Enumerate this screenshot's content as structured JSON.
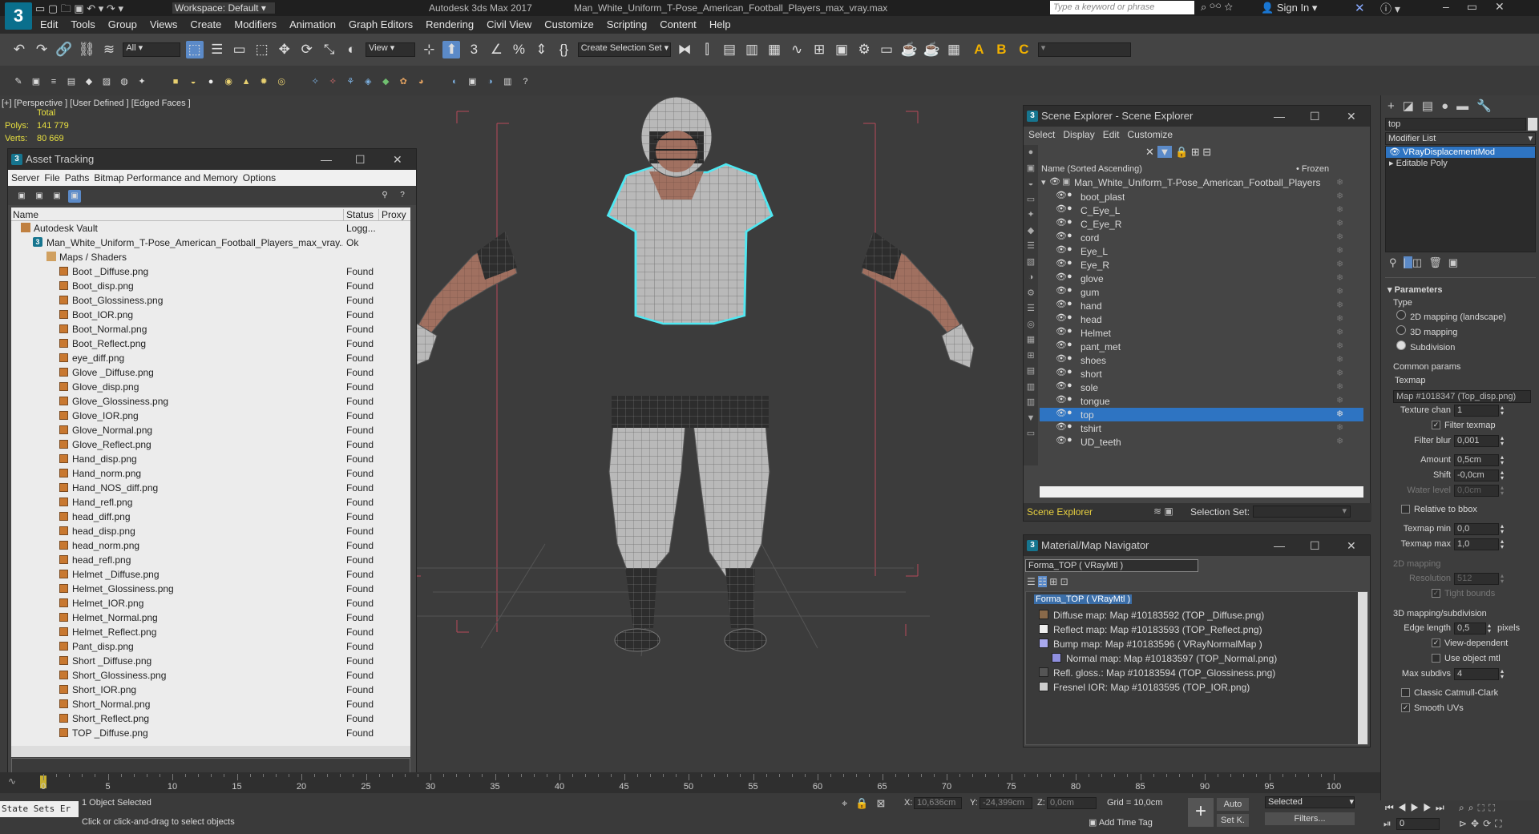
{
  "title_bar": {
    "workspace": "Workspace: Default",
    "app_title": "Autodesk 3ds Max 2017",
    "file_name": "Man_White_Uniform_T-Pose_American_Football_Players_max_vray.max",
    "search_placeholder": "Type a keyword or phrase",
    "sign_in": "Sign In"
  },
  "menu": [
    "Edit",
    "Tools",
    "Group",
    "Views",
    "Create",
    "Modifiers",
    "Animation",
    "Graph Editors",
    "Rendering",
    "Civil View",
    "Customize",
    "Scripting",
    "Content",
    "Help"
  ],
  "toolbar": {
    "filter": "All",
    "view": "View",
    "selection_set": "Create Selection Set"
  },
  "viewport": {
    "label": "[+] [Perspective ] [User Defined ] [Edged Faces ]",
    "stats_total": "Total",
    "polys_label": "Polys:",
    "polys_value": "141 779",
    "verts_label": "Verts:",
    "verts_value": "80 669"
  },
  "asset_tracking": {
    "title": "Asset Tracking",
    "menu": [
      "Server",
      "File",
      "Paths",
      "Bitmap Performance and Memory",
      "Options"
    ],
    "columns": [
      "Name",
      "Status",
      "Proxy"
    ],
    "vault": {
      "name": "Autodesk Vault",
      "status": "Logg..."
    },
    "file": {
      "name": "Man_White_Uniform_T-Pose_American_Football_Players_max_vray....",
      "status": "Ok"
    },
    "folder": "Maps / Shaders",
    "found_label": "Found",
    "files": [
      "Boot _Diffuse.png",
      "Boot_disp.png",
      "Boot_Glossiness.png",
      "Boot_IOR.png",
      "Boot_Normal.png",
      "Boot_Reflect.png",
      "eye_diff.png",
      "Glove _Diffuse.png",
      "Glove_disp.png",
      "Glove_Glossiness.png",
      "Glove_IOR.png",
      "Glove_Normal.png",
      "Glove_Reflect.png",
      "Hand_disp.png",
      "Hand_norm.png",
      "Hand_NOS_diff.png",
      "Hand_refl.png",
      "head_diff.png",
      "head_disp.png",
      "head_norm.png",
      "head_refl.png",
      "Helmet _Diffuse.png",
      "Helmet_Glossiness.png",
      "Helmet_IOR.png",
      "Helmet_Normal.png",
      "Helmet_Reflect.png",
      "Pant_disp.png",
      "Short _Diffuse.png",
      "Short_Glossiness.png",
      "Short_IOR.png",
      "Short_Normal.png",
      "Short_Reflect.png",
      "TOP _Diffuse.png"
    ]
  },
  "scene_explorer": {
    "title": "Scene Explorer - Scene Explorer",
    "menu": [
      "Select",
      "Display",
      "Edit",
      "Customize"
    ],
    "col_name": "Name (Sorted Ascending)",
    "col_frozen": "• Frozen",
    "root": "Man_White_Uniform_T-Pose_American_Football_Players",
    "objects": [
      "boot_plast",
      "C_Eye_L",
      "C_Eye_R",
      "cord",
      "Eye_L",
      "Eye_R",
      "glove",
      "gum",
      "hand",
      "head",
      "Helmet",
      "pant_met",
      "shoes",
      "short",
      "sole",
      "tongue",
      "top",
      "tshirt",
      "UD_teeth"
    ],
    "selected": "top",
    "footer_label": "Scene Explorer",
    "selection_set_label": "Selection Set:"
  },
  "material_navigator": {
    "title": "Material/Map Navigator",
    "field": "Forma_TOP  ( VRayMtl )",
    "root": "Forma_TOP  ( VRayMtl )",
    "maps": [
      {
        "text": "Diffuse map: Map #10183592 (TOP _Diffuse.png)",
        "color": "#8a6a4a"
      },
      {
        "text": "Reflect map: Map #10183593 (TOP_Reflect.png)",
        "color": "#eeeeee"
      },
      {
        "text": "Bump map: Map #10183596  ( VRayNormalMap )",
        "color": "#a9a9ee"
      },
      {
        "text": "Normal map: Map #10183597 (TOP_Normal.png)",
        "color": "#8f8fdf"
      },
      {
        "text": "Refl. gloss.: Map #10183594 (TOP_Glossiness.png)",
        "color": "#555555"
      },
      {
        "text": "Fresnel IOR: Map #10183595 (TOP_IOR.png)",
        "color": "#cccccc"
      }
    ]
  },
  "command_panel": {
    "object_name": "top",
    "modifier_list": "Modifier List",
    "modifiers": [
      "VRayDisplacementMod",
      "Editable Poly"
    ],
    "rollout": "Parameters",
    "type_label": "Type",
    "types": [
      "2D mapping (landscape)",
      "3D mapping",
      "Subdivision"
    ],
    "common_params": "Common params",
    "texmap_label": "Texmap",
    "texmap_value": "Map #1018347 (Top_disp.png)",
    "texture_chan_label": "Texture chan",
    "texture_chan_value": "1",
    "filter_texmap": "Filter texmap",
    "filter_blur_label": "Filter blur",
    "filter_blur_value": "0,001",
    "amount_label": "Amount",
    "amount_value": "0,5cm",
    "shift_label": "Shift",
    "shift_value": "-0,0cm",
    "water_level_label": "Water level",
    "water_level_value": "0,0cm",
    "relative_bbox": "Relative to bbox",
    "texmap_min_label": "Texmap min",
    "texmap_min_value": "0,0",
    "texmap_max_label": "Texmap max",
    "texmap_max_value": "1,0",
    "mapping2d": "2D mapping",
    "resolution_label": "Resolution",
    "resolution_value": "512",
    "tight_bounds": "Tight bounds",
    "mapping3d": "3D mapping/subdivision",
    "edge_length_label": "Edge length",
    "edge_length_value": "0,5",
    "pixels": "pixels",
    "view_dependent": "View-dependent",
    "use_object_mtl": "Use object mtl",
    "max_subdivs_label": "Max subdivs",
    "max_subdivs_value": "4",
    "classic_cc": "Classic Catmull-Clark",
    "smooth_uvs": "Smooth UVs"
  },
  "timeline": {
    "ticks": [
      "0",
      "5",
      "10",
      "15",
      "20",
      "25",
      "30",
      "35",
      "40",
      "45",
      "50",
      "55",
      "60",
      "65",
      "70",
      "75",
      "80",
      "85",
      "90",
      "95",
      "100"
    ]
  },
  "status": {
    "state_sets": "State Sets Er",
    "selected_text": "1 Object Selected",
    "prompt": "Click or click-and-drag to select objects",
    "x_label": "X:",
    "x_value": "10,636cm",
    "y_label": "Y:",
    "y_value": "-24,399cm",
    "z_label": "Z:",
    "z_value": "0,0cm",
    "grid": "Grid = 10,0cm",
    "add_time_tag": "Add Time Tag",
    "auto": "Auto",
    "set_k": "Set K.",
    "selected_dd": "Selected",
    "filters": "Filters...",
    "frame": "0"
  }
}
